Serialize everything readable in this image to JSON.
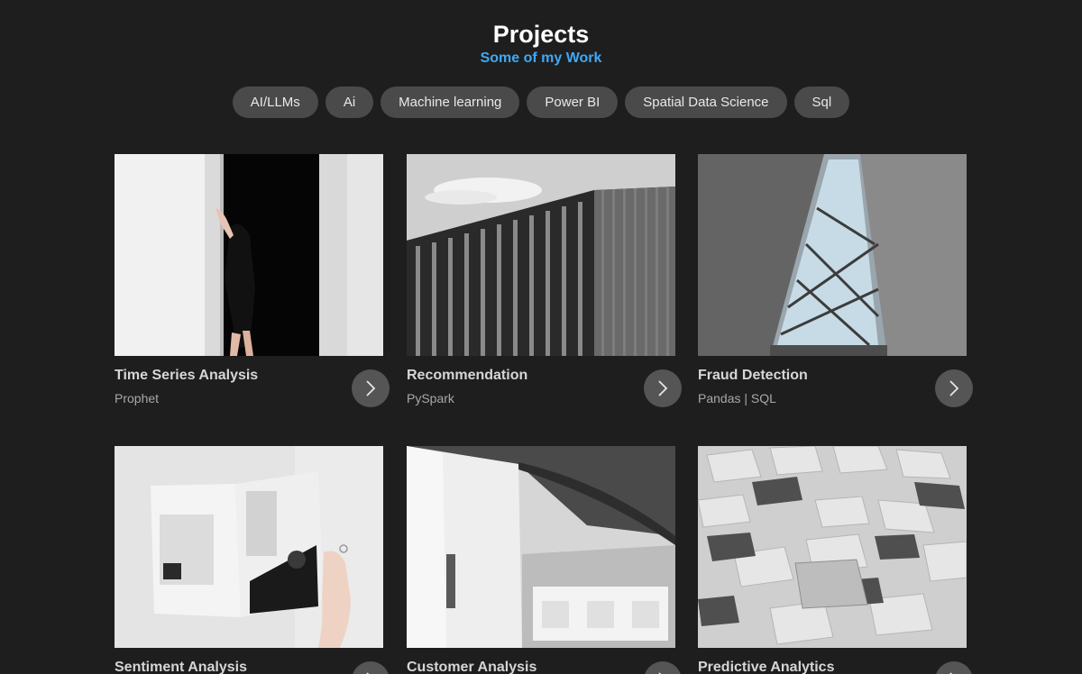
{
  "header": {
    "title": "Projects",
    "subtitle": "Some of my Work"
  },
  "filters": [
    "AI/LLMs",
    "Ai",
    "Machine learning",
    "Power BI",
    "Spatial Data Science",
    "Sql"
  ],
  "projects": [
    {
      "title": "Time Series Analysis",
      "tags": "Prophet",
      "image": "woman-in-doorway"
    },
    {
      "title": "Recommendation",
      "tags": "PySpark",
      "image": "wooden-slat-building"
    },
    {
      "title": "Fraud Detection",
      "tags": "Pandas | SQL",
      "image": "triangular-skylight"
    },
    {
      "title": "Sentiment Analysis",
      "tags": "",
      "image": "open-magazine"
    },
    {
      "title": "Customer Analysis",
      "tags": "",
      "image": "white-modern-building"
    },
    {
      "title": "Predictive Analytics",
      "tags": "",
      "image": "metal-tiles"
    }
  ],
  "icons": {
    "arrow": "chevron-right-icon"
  },
  "colors": {
    "background": "#1e1e1e",
    "accent": "#3fa9f5",
    "chip": "#4a4a4a",
    "arrow_button": "#555555"
  }
}
